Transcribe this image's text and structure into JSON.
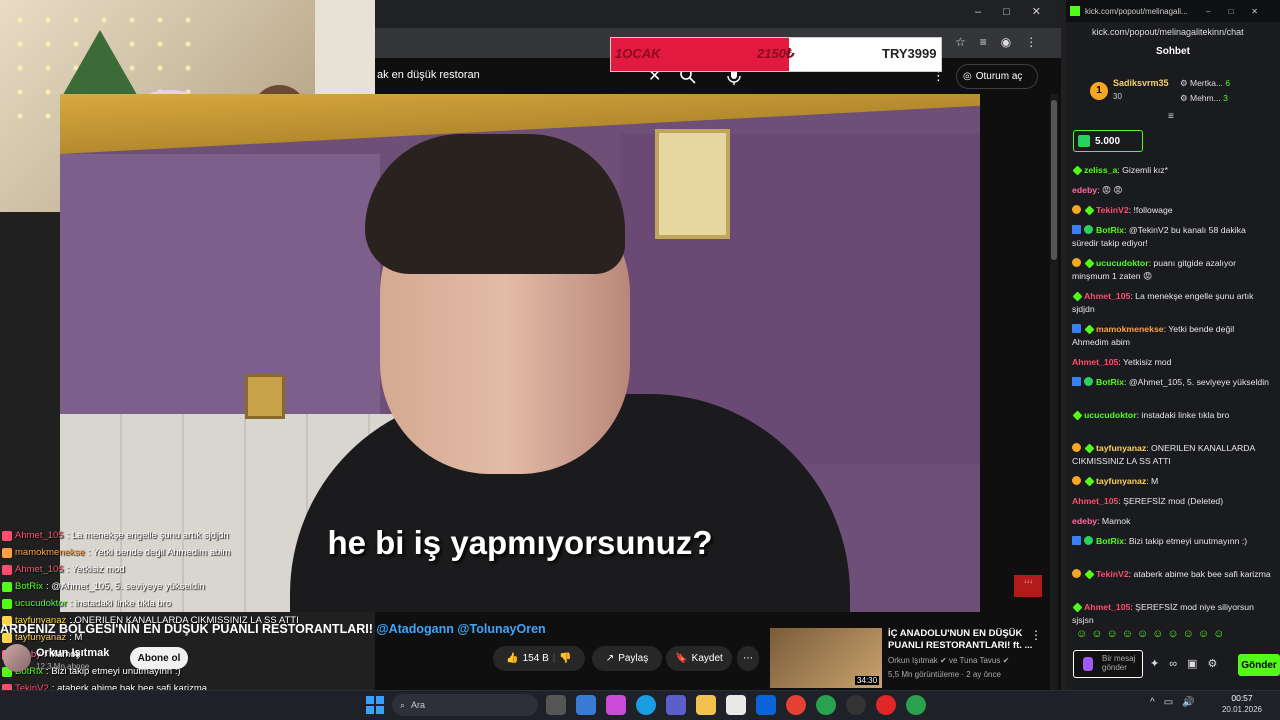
{
  "youtube": {
    "search_query": "ak en düşük restoran",
    "signin_label": "Oturum aç",
    "subtitle": "he bi iş yapmıyorsunuz?",
    "video_title_main": "ARDENIZ BÖLGESİ'NİN EN DÜŞÜK PUANLI RESTORANTLARI! ",
    "video_title_mentions": "@Atadogann @TolunayOren",
    "channel_name": "Orkun Işıtmak",
    "channel_subs": "12,3 Mn abone",
    "subscribe_label": "Abone ol",
    "likes": "154 B",
    "share_label": "Paylaş",
    "save_label": "Kaydet",
    "related": {
      "title": "İÇ ANADOLU'NUN EN DÜŞÜK PUANLI RESTORANTLARI! ft. ...",
      "channel": "Orkun Işıtmak ✔ ve Tuna Tavus ✔",
      "meta": "5,5 Mn görüntüleme · 2 ay önce",
      "duration": "34:30"
    }
  },
  "donation_goal": {
    "label": "1OCAK",
    "current": "2150₺",
    "goal": "TRY3999",
    "progress": 0.54,
    "fill_color": "#e4193f"
  },
  "overlay_chat": [
    {
      "user": "Ahmet_105",
      "text": "La menekşe engelle şunu artık sjdjdn",
      "color": "#ff4d6d"
    },
    {
      "user": "mamokmenekse",
      "text": "Yetki bende değil Ahmedim abim",
      "color": "#ff9f43"
    },
    {
      "user": "Ahmet_105",
      "text": "Yetkisiz mod",
      "color": "#ff4d6d"
    },
    {
      "user": "BotRix",
      "text": "@Ahmet_105, 5. seviyeye yükseldin",
      "color": "#53fc18"
    },
    {
      "user": "ucucudoktor",
      "text": "instadaki linke tıkla bro",
      "color": "#53fc18"
    },
    {
      "user": "tayfunyanaz",
      "text": "ONERILEN KANALLARDA CIKMISSINIZ LA SS ATTI",
      "color": "#ffd34d"
    },
    {
      "user": "tayfunyanaz",
      "text": "M",
      "color": "#ffd34d"
    },
    {
      "user": "edeby",
      "text": "Mamok",
      "color": "#ff6b9a"
    },
    {
      "user": "BotRix",
      "text": "Bizi takip etmeyi unutmayınn :)",
      "color": "#53fc18"
    },
    {
      "user": "TekinV2",
      "text": "ataberk abime bak bee safi karizma",
      "color": "#ff4d6d"
    },
    {
      "user": "Ahmet_105",
      "text": "ŞEREFSİZ mod niye siliyorsun sjsjsn",
      "color": "#ff4d6d"
    }
  ],
  "kick": {
    "url": "kick.com/popout/melinagalitekinn/chat",
    "title_url": "kick.com/popout/melinagali...",
    "header": "Sohbet",
    "leaderboard": [
      {
        "rank": "1",
        "name": "Sadiksvrm35",
        "count": "30"
      },
      {
        "name": "Mertka...",
        "count": "6"
      },
      {
        "name": "Mehm...",
        "count": "3"
      }
    ],
    "pinned_gift": "5.000",
    "messages": [
      {
        "user": "zeliss_a",
        "text": "Gizemli kız*",
        "color": "#53fc18",
        "badges": [
          "green"
        ]
      },
      {
        "user": "edeby",
        "text": "😡 😡",
        "color": "#ff6b9a",
        "badges": []
      },
      {
        "user": "TekinV2",
        "text": "!followage",
        "color": "#ff4d6d",
        "badges": [
          "gold",
          "green"
        ]
      },
      {
        "user": "BotRix",
        "text": "@TekinV2 bu kanalı 58 dakika süredir takip ediyor!",
        "color": "#53fc18",
        "badges": [
          "blue",
          "verified"
        ]
      },
      {
        "user": "ucucudoktor",
        "text": "puanı gitgide azalıyor minşmum 1 zaten 😡",
        "color": "#53fc18",
        "badges": [
          "gold",
          "green"
        ]
      },
      {
        "user": "Ahmet_105",
        "text": "La menekşe engelle şunu artık sjdjdn",
        "color": "#ff4d6d",
        "badges": [
          "green"
        ]
      },
      {
        "user": "mamokmenekse",
        "text": "Yetki bende değil Ahmedim abim",
        "color": "#ff9f43",
        "badges": [
          "blue",
          "green"
        ]
      },
      {
        "user": "Ahmet_105",
        "text": "Yetkisiz mod",
        "color": "#ff4d6d",
        "badges": []
      },
      {
        "user": "BotRix",
        "text": "@Ahmet_105, 5. seviyeye yükseldin",
        "color": "#53fc18",
        "badges": [
          "blue",
          "verified"
        ]
      },
      {
        "user": "ucucudoktor",
        "text": "instadaki linke tıkla bro",
        "color": "#53fc18",
        "badges": [
          "green"
        ]
      },
      {
        "user": "tayfunyanaz",
        "text": "ONERILEN KANALLARDA CIKMISSINIZ LA SS ATTI",
        "color": "#ffd34d",
        "badges": [
          "gold",
          "green"
        ]
      },
      {
        "user": "tayfunyanaz",
        "text": "M",
        "color": "#ffd34d",
        "badges": [
          "gold",
          "green"
        ]
      },
      {
        "user": "Ahmet_105",
        "text": "ŞEREFSİZ mod (Deleted)",
        "color": "#ff4d6d",
        "badges": []
      },
      {
        "user": "edeby",
        "text": "Mamok",
        "color": "#ff6b9a",
        "badges": []
      },
      {
        "user": "BotRix",
        "text": "Bizi takip etmeyi unutmayınn :)",
        "color": "#53fc18",
        "badges": [
          "blue",
          "verified"
        ]
      },
      {
        "user": "TekinV2",
        "text": "ataberk abime bak bee safi karizma",
        "color": "#ff4d6d",
        "badges": [
          "gold",
          "green"
        ]
      },
      {
        "user": "Ahmet_105",
        "text": "ŞEREFSİZ mod niye siliyorsun sjsjsn",
        "color": "#ff4d6d",
        "badges": [
          "green"
        ]
      }
    ],
    "input_placeholder": "Bir mesaj gönder",
    "send_label": "Gönder"
  },
  "taskbar": {
    "search_placeholder": "Ara",
    "time": "00:57",
    "date": "20.01.2026"
  }
}
